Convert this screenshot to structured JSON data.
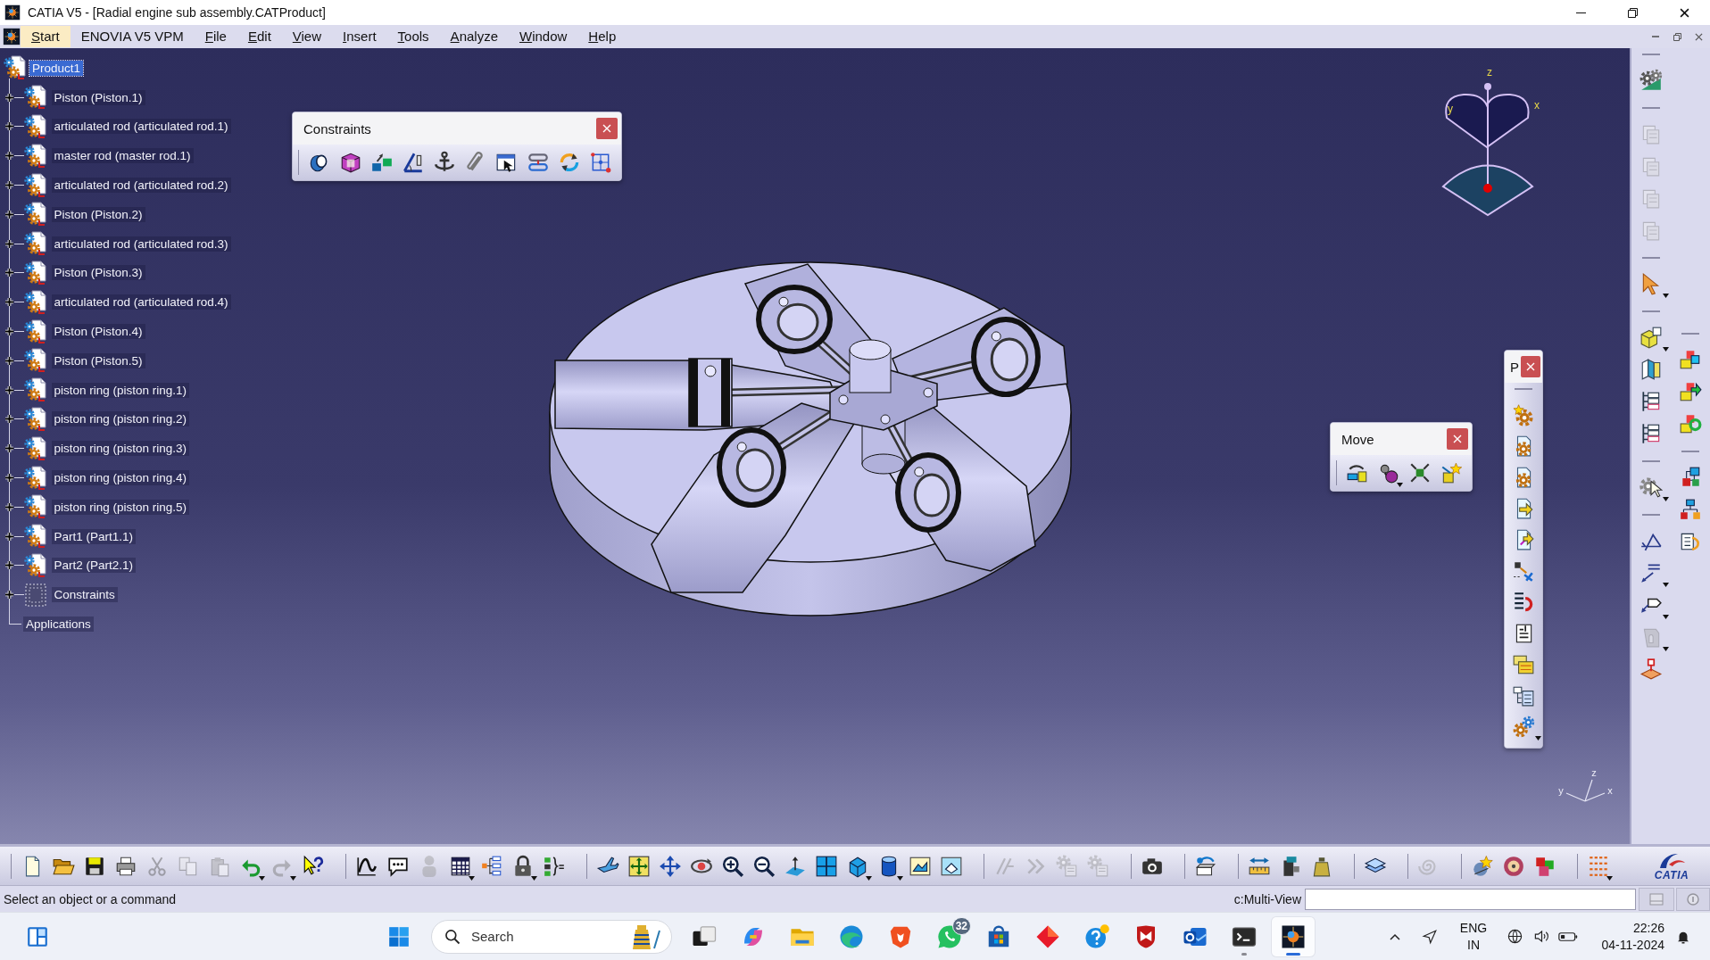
{
  "window": {
    "title": "CATIA V5 - [Radial engine sub assembly.CATProduct]"
  },
  "menu": [
    {
      "label": "Start",
      "selected": true,
      "mnemonic": true
    },
    {
      "label": "ENOVIA V5 VPM",
      "selected": false,
      "mnemonic": false
    },
    {
      "label": "File",
      "selected": false,
      "mnemonic": true
    },
    {
      "label": "Edit",
      "selected": false,
      "mnemonic": true
    },
    {
      "label": "View",
      "selected": false,
      "mnemonic": true
    },
    {
      "label": "Insert",
      "selected": false,
      "mnemonic": true
    },
    {
      "label": "Tools",
      "selected": false,
      "mnemonic": true
    },
    {
      "label": "Analyze",
      "selected": false,
      "mnemonic": true
    },
    {
      "label": "Window",
      "selected": false,
      "mnemonic": true
    },
    {
      "label": "Help",
      "selected": false,
      "mnemonic": true
    }
  ],
  "tree": [
    {
      "kind": "product",
      "label": "Product1",
      "selected": true,
      "children": [
        {
          "kind": "component",
          "label": "Piston (Piston.1)",
          "selected": false,
          "expanded": false
        },
        {
          "kind": "component",
          "label": "articulated rod (articulated rod.1)",
          "selected": false,
          "expanded": false
        },
        {
          "kind": "component",
          "label": "master rod (master rod.1)",
          "selected": false,
          "expanded": false
        },
        {
          "kind": "component",
          "label": "articulated rod (articulated rod.2)",
          "selected": false,
          "expanded": false
        },
        {
          "kind": "component",
          "label": "Piston (Piston.2)",
          "selected": false,
          "expanded": false
        },
        {
          "kind": "component",
          "label": "articulated rod (articulated rod.3)",
          "selected": false,
          "expanded": false
        },
        {
          "kind": "component",
          "label": "Piston (Piston.3)",
          "selected": false,
          "expanded": false
        },
        {
          "kind": "component",
          "label": "articulated rod (articulated rod.4)",
          "selected": false,
          "expanded": false
        },
        {
          "kind": "component",
          "label": "Piston (Piston.4)",
          "selected": false,
          "expanded": false
        },
        {
          "kind": "component",
          "label": "Piston (Piston.5)",
          "selected": false,
          "expanded": false
        },
        {
          "kind": "component",
          "label": "piston ring (piston ring.1)",
          "selected": false,
          "expanded": false
        },
        {
          "kind": "component",
          "label": "piston ring (piston ring.2)",
          "selected": false,
          "expanded": false
        },
        {
          "kind": "component",
          "label": "piston ring (piston ring.3)",
          "selected": false,
          "expanded": false
        },
        {
          "kind": "component",
          "label": "piston ring (piston ring.4)",
          "selected": false,
          "expanded": false
        },
        {
          "kind": "component",
          "label": "piston ring (piston ring.5)",
          "selected": false,
          "expanded": false
        },
        {
          "kind": "component",
          "label": "Part1 (Part1.1)",
          "selected": false,
          "expanded": false
        },
        {
          "kind": "component",
          "label": "Part2 (Part2.1)",
          "selected": false,
          "expanded": false
        },
        {
          "kind": "constraints",
          "label": "Constraints",
          "selected": false,
          "expanded": false
        }
      ]
    },
    {
      "kind": "applications",
      "label": "Applications",
      "selected": false
    }
  ],
  "constraints_toolbar": {
    "title": "Constraints",
    "buttons": [
      {
        "disabled": false
      },
      {
        "disabled": false
      },
      {
        "disabled": false
      },
      {
        "disabled": false
      },
      {
        "disabled": false
      },
      {
        "disabled": false
      },
      {
        "disabled": false
      },
      {
        "disabled": false
      },
      {
        "disabled": false
      },
      {
        "disabled": false
      }
    ]
  },
  "move_toolbar": {
    "title": "Move",
    "buttons": [
      {
        "disabled": false
      },
      {
        "disabled": false
      },
      {
        "disabled": false
      },
      {
        "disabled": false
      }
    ]
  },
  "product_toolbar": {
    "title": "P",
    "buttons": [
      {
        "disabled": false
      },
      {
        "disabled": false
      },
      {
        "disabled": false
      },
      {
        "disabled": false
      },
      {
        "disabled": false
      },
      {
        "disabled": false
      },
      {
        "disabled": false
      },
      {
        "disabled": false
      },
      {
        "disabled": false
      },
      {
        "disabled": false
      },
      {
        "disabled": false
      }
    ]
  },
  "compass": {
    "axes": [
      "z",
      "y",
      "x"
    ]
  },
  "axis_triad": {
    "axes": [
      "z",
      "y",
      "x"
    ]
  },
  "right_toolbars": {
    "left_column": [
      {
        "buttons": [
          {
            "disabled": false
          }
        ]
      },
      {
        "buttons": [
          {
            "disabled": true
          },
          {
            "disabled": true
          },
          {
            "disabled": true
          },
          {
            "disabled": true
          }
        ]
      },
      {
        "buttons": [
          {
            "disabled": false
          }
        ]
      },
      {
        "buttons": [
          {
            "disabled": false
          },
          {
            "disabled": false
          },
          {
            "disabled": false
          },
          {
            "disabled": false
          }
        ]
      },
      {
        "buttons": [
          {
            "disabled": false
          }
        ]
      },
      {
        "buttons": [
          {
            "disabled": false
          },
          {
            "disabled": false
          },
          {
            "disabled": false
          },
          {
            "disabled": true
          },
          {
            "disabled": false
          }
        ]
      }
    ],
    "right_column": [
      {
        "buttons": [
          {
            "disabled": false
          },
          {
            "disabled": false
          },
          {
            "disabled": false
          }
        ]
      },
      {
        "buttons": [
          {
            "disabled": false
          },
          {
            "disabled": false
          },
          {
            "disabled": false
          }
        ]
      }
    ]
  },
  "standard_toolbar": {
    "groups": [
      {
        "buttons": [
          {
            "disabled": false
          },
          {
            "disabled": false
          },
          {
            "disabled": false
          },
          {
            "disabled": false
          },
          {
            "disabled": true
          },
          {
            "disabled": true
          },
          {
            "disabled": true
          },
          {
            "disabled": false
          },
          {
            "disabled": true
          },
          {
            "disabled": false
          }
        ]
      },
      {
        "buttons": [
          {
            "disabled": false
          },
          {
            "disabled": false
          },
          {
            "disabled": true
          },
          {
            "disabled": false
          },
          {
            "disabled": false
          },
          {
            "disabled": false
          },
          {
            "disabled": false
          }
        ]
      },
      {
        "buttons": [
          {
            "disabled": false
          },
          {
            "disabled": false
          },
          {
            "disabled": false
          },
          {
            "disabled": false
          },
          {
            "disabled": false
          },
          {
            "disabled": false
          },
          {
            "disabled": false
          },
          {
            "disabled": false
          },
          {
            "disabled": false
          },
          {
            "disabled": false
          },
          {
            "disabled": false
          },
          {
            "disabled": false
          }
        ]
      },
      {
        "buttons": [
          {
            "disabled": true
          },
          {
            "disabled": true
          },
          {
            "disabled": true
          },
          {
            "disabled": true
          }
        ]
      },
      {
        "buttons": [
          {
            "disabled": false
          }
        ]
      },
      {
        "buttons": [
          {
            "disabled": false
          }
        ]
      },
      {
        "buttons": [
          {
            "disabled": false
          },
          {
            "disabled": false
          },
          {
            "disabled": false
          }
        ]
      },
      {
        "buttons": [
          {
            "disabled": false
          }
        ]
      },
      {
        "buttons": [
          {
            "disabled": true
          }
        ]
      },
      {
        "buttons": [
          {
            "disabled": false
          },
          {
            "disabled": false
          },
          {
            "disabled": false
          }
        ]
      },
      {
        "buttons": [
          {
            "disabled": false
          }
        ]
      }
    ]
  },
  "brand_logo": {
    "text": "CATIA"
  },
  "status_bar": {
    "message": "Select an object or a command",
    "command_label": "c:Multi-View",
    "buttons": [
      {
        "disabled": true
      },
      {
        "disabled": true
      }
    ]
  },
  "taskbar": {
    "search": {
      "placeholder": "Search"
    },
    "apps": [
      {
        "running": false,
        "selected": false
      },
      {
        "running": false,
        "selected": false
      },
      {
        "running": false,
        "selected": false
      },
      {
        "running": false,
        "selected": false
      },
      {
        "running": false,
        "selected": false
      },
      {
        "running": false,
        "selected": false,
        "badge": "32"
      },
      {
        "running": false,
        "selected": false
      },
      {
        "running": false,
        "selected": false
      },
      {
        "running": false,
        "selected": false
      },
      {
        "running": false,
        "selected": false
      },
      {
        "running": false,
        "selected": false
      },
      {
        "running": true,
        "selected": false
      },
      {
        "running": true,
        "selected": true
      }
    ],
    "language": {
      "code": "ENG",
      "region": "IN"
    },
    "clock": {
      "time": "22:26",
      "date": "04-11-2024"
    }
  }
}
